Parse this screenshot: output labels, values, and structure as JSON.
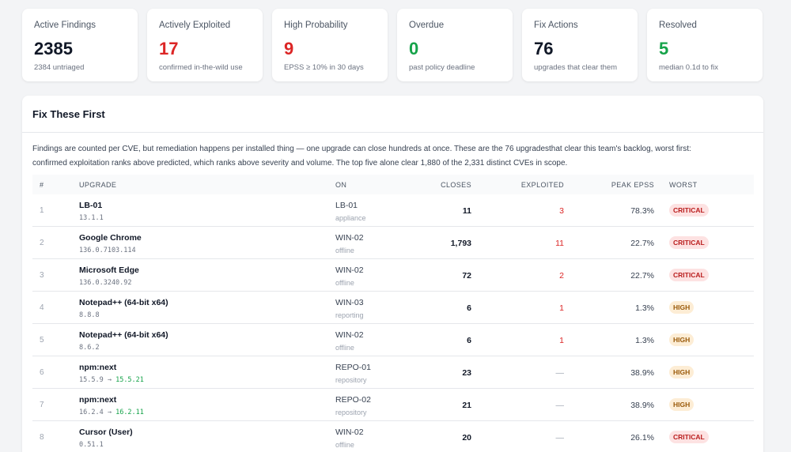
{
  "stats": [
    {
      "label": "Active Findings",
      "value": "2385",
      "sub": "2384 untriaged",
      "color": "#111827"
    },
    {
      "label": "Actively Exploited",
      "value": "17",
      "sub": "confirmed in-the-wild use",
      "color": "#dc2626"
    },
    {
      "label": "High Probability",
      "value": "9",
      "sub": "EPSS ≥ 10% in 30 days",
      "color": "#dc2626"
    },
    {
      "label": "Overdue",
      "value": "0",
      "sub": "past policy deadline",
      "color": "#16a34a"
    },
    {
      "label": "Fix Actions",
      "value": "76",
      "sub": "upgrades that clear them",
      "color": "#111827"
    },
    {
      "label": "Resolved",
      "value": "5",
      "sub": "median 0.1d to fix",
      "color": "#16a34a"
    }
  ],
  "panel": {
    "title": "Fix These First",
    "intro_line1": "Findings are counted per CVE, but remediation happens per installed thing — one upgrade can close hundreds at once. These are the 76 upgradesthat clear this team's backlog, worst first:",
    "intro_line2": "confirmed exploitation ranks above predicted, which ranks above severity and volume. The top five alone clear 1,880 of the 2,331 distinct CVEs in scope."
  },
  "table": {
    "headers": {
      "num": "#",
      "upgrade": "Upgrade",
      "on": "On",
      "closes": "Closes",
      "exploited": "Exploited",
      "epss": "Peak EPSS",
      "worst": "Worst"
    },
    "rows": [
      {
        "num": "1",
        "name": "LB-01",
        "version": "13.1.1",
        "to": "",
        "host": "LB-01",
        "state": "appliance",
        "closes": "11",
        "exploited": "3",
        "epss": "78.3%",
        "worst": "CRITICAL",
        "level": "critical"
      },
      {
        "num": "2",
        "name": "Google Chrome",
        "version": "136.0.7103.114",
        "to": "",
        "host": "WIN-02",
        "state": "offline",
        "closes": "1,793",
        "exploited": "11",
        "epss": "22.7%",
        "worst": "CRITICAL",
        "level": "critical"
      },
      {
        "num": "3",
        "name": "Microsoft Edge",
        "version": "136.0.3240.92",
        "to": "",
        "host": "WIN-02",
        "state": "offline",
        "closes": "72",
        "exploited": "2",
        "epss": "22.7%",
        "worst": "CRITICAL",
        "level": "critical"
      },
      {
        "num": "4",
        "name": "Notepad++ (64-bit x64)",
        "version": "8.8.8",
        "to": "",
        "host": "WIN-03",
        "state": "reporting",
        "closes": "6",
        "exploited": "1",
        "epss": "1.3%",
        "worst": "HIGH",
        "level": "high"
      },
      {
        "num": "5",
        "name": "Notepad++ (64-bit x64)",
        "version": "8.6.2",
        "to": "",
        "host": "WIN-02",
        "state": "offline",
        "closes": "6",
        "exploited": "1",
        "epss": "1.3%",
        "worst": "HIGH",
        "level": "high"
      },
      {
        "num": "6",
        "name": "npm:next",
        "version": "15.5.9",
        "to": "15.5.21",
        "host": "REPO-01",
        "state": "repository",
        "closes": "23",
        "exploited": "—",
        "epss": "38.9%",
        "worst": "HIGH",
        "level": "high"
      },
      {
        "num": "7",
        "name": "npm:next",
        "version": "16.2.4",
        "to": "16.2.11",
        "host": "REPO-02",
        "state": "repository",
        "closes": "21",
        "exploited": "—",
        "epss": "38.9%",
        "worst": "HIGH",
        "level": "high"
      },
      {
        "num": "8",
        "name": "Cursor (User)",
        "version": "0.51.1",
        "to": "",
        "host": "WIN-02",
        "state": "offline",
        "closes": "20",
        "exploited": "—",
        "epss": "26.1%",
        "worst": "CRITICAL",
        "level": "critical"
      }
    ]
  }
}
